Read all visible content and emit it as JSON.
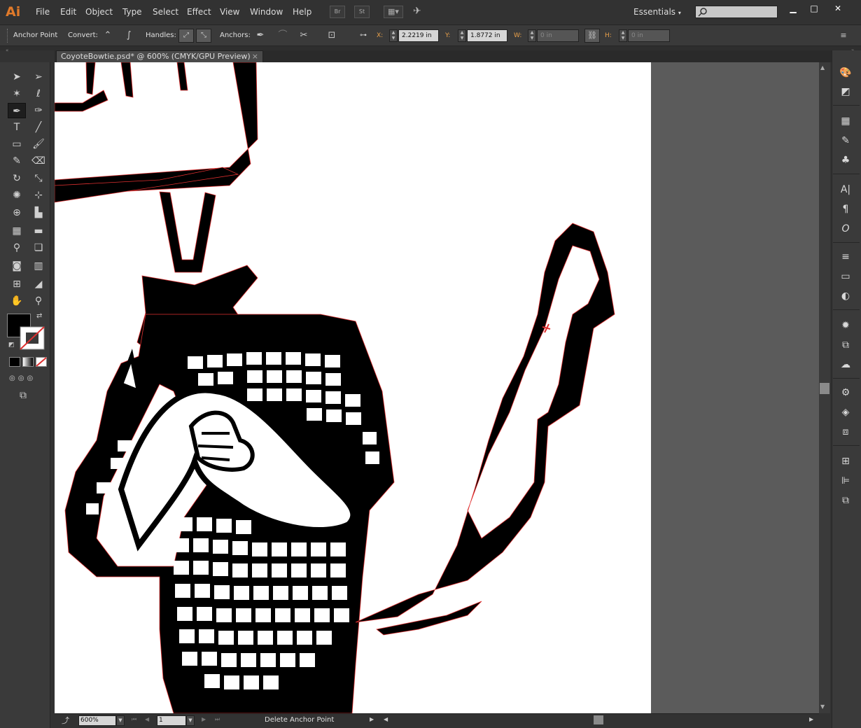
{
  "app": {
    "logo": "Ai"
  },
  "menu": {
    "items": [
      "File",
      "Edit",
      "Object",
      "Type",
      "Select",
      "Effect",
      "View",
      "Window",
      "Help"
    ]
  },
  "menubar_buttons": {
    "bridge": "Br",
    "stock": "St"
  },
  "workspace": {
    "label": "Essentials",
    "search_placeholder": ""
  },
  "control_panel": {
    "tool_name": "Anchor Point",
    "convert_label": "Convert:",
    "handles_label": "Handles:",
    "anchors_label": "Anchors:",
    "x_label": "X:",
    "x_value": "2.2219 in",
    "y_label": "Y:",
    "y_value": "1.8772 in",
    "w_label": "W:",
    "w_value": "0 in",
    "h_label": "H:",
    "h_value": "0 in"
  },
  "document": {
    "tab_title": "CoyoteBowtie.psd* @ 600% (CMYK/GPU Preview)",
    "close": "×"
  },
  "statusbar": {
    "zoom": "600%",
    "page": "1",
    "status_text": "Delete Anchor Point"
  },
  "colors": {
    "accent": "#e07a2a",
    "path_selection": "#e03030",
    "fill": "#000000",
    "stroke": "none"
  }
}
